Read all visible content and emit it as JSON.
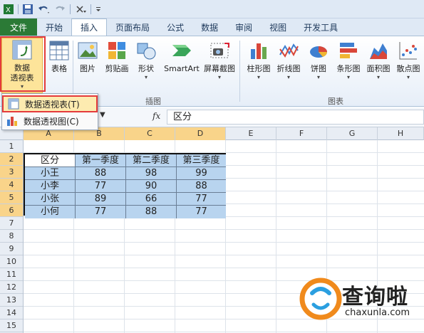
{
  "qat": {
    "save_icon": "save-icon",
    "undo_icon": "undo-icon",
    "redo_icon": "redo-icon",
    "customize_icon": "customize-icon"
  },
  "tabs": [
    {
      "label": "文件"
    },
    {
      "label": "开始"
    },
    {
      "label": "插入"
    },
    {
      "label": "页面布局"
    },
    {
      "label": "公式"
    },
    {
      "label": "数据"
    },
    {
      "label": "审阅"
    },
    {
      "label": "视图"
    },
    {
      "label": "开发工具"
    }
  ],
  "ribbon": {
    "pivot": {
      "line1": "数据",
      "line2": "透视表",
      "caret": "▾"
    },
    "table": {
      "label": "表格"
    },
    "picture": {
      "label": "图片"
    },
    "clipart": {
      "label": "剪贴画"
    },
    "shapes": {
      "label": "形状"
    },
    "smartart": {
      "label": "SmartArt"
    },
    "screenshot": {
      "label": "屏幕截图"
    },
    "col_chart": {
      "label": "柱形图"
    },
    "line_chart": {
      "label": "折线图"
    },
    "pie_chart": {
      "label": "饼图"
    },
    "bar_chart": {
      "label": "条形图"
    },
    "area_chart": {
      "label": "面积图"
    },
    "scatter_chart": {
      "label": "散点图"
    },
    "group_illustrations": "插图",
    "group_charts": "图表"
  },
  "pivot_menu": {
    "item1": "数据透视表(T)",
    "item2": "数据透视图(C)"
  },
  "formula_bar": {
    "fx": "fx",
    "content": "区分",
    "dropdown": "▼"
  },
  "columns": [
    "A",
    "B",
    "C",
    "D",
    "E",
    "F",
    "G",
    "H"
  ],
  "rows": [
    "1",
    "2",
    "3",
    "4",
    "5",
    "6",
    "7",
    "8",
    "9",
    "10",
    "11",
    "12",
    "13",
    "14",
    "15"
  ],
  "table": {
    "header": [
      "区分",
      "第一季度",
      "第二季度",
      "第三季度"
    ],
    "body": [
      [
        "小王",
        "88",
        "98",
        "99"
      ],
      [
        "小李",
        "77",
        "90",
        "88"
      ],
      [
        "小张",
        "89",
        "66",
        "77"
      ],
      [
        "小何",
        "77",
        "88",
        "77"
      ]
    ]
  },
  "watermark": {
    "brand": "查询啦",
    "url": "chaxunla.com"
  },
  "colors": {
    "file_tab": "#2b7a36",
    "highlight": "#e43b3b",
    "selection": "#b8d4ef",
    "header_sel": "#f9d48a"
  }
}
